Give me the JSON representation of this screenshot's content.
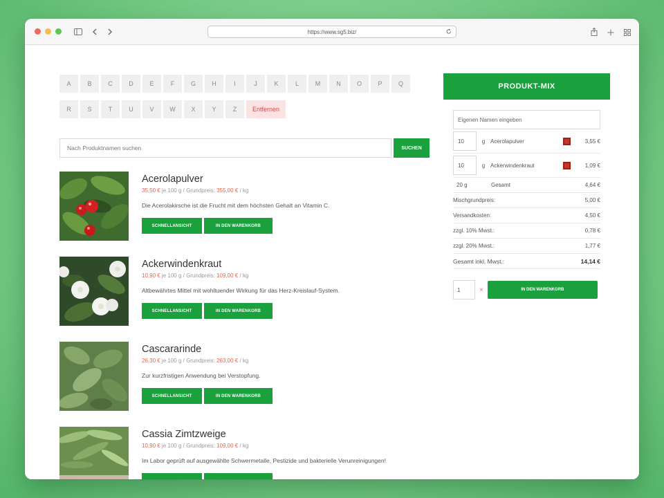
{
  "browser": {
    "url": "https://www.sg5.biz/"
  },
  "alphabet": {
    "row1": [
      "A",
      "B",
      "C",
      "D",
      "E",
      "F",
      "G",
      "H",
      "I",
      "J",
      "K",
      "L",
      "M",
      "N",
      "O",
      "P",
      "Q"
    ],
    "row2": [
      "R",
      "S",
      "T",
      "U",
      "V",
      "W",
      "X",
      "Y",
      "Z"
    ],
    "remove_label": "Entfernen"
  },
  "search": {
    "placeholder": "Nach Produktnamen suchen",
    "button": "SUCHEN"
  },
  "buttons": {
    "quick_view": "SCHNELLANSICHT",
    "add_to_cart": "IN DEN WARENKORB"
  },
  "products": [
    {
      "name": "Acerolapulver",
      "price": "35,50 €",
      "unit_text": " je 100 g / Grundpreis: ",
      "base_price": "355,00 €",
      "per": " / kg",
      "desc": "Die Acerolakirsche ist die Frucht mit dem höchsten Gehalt an Vitamin C."
    },
    {
      "name": "Ackerwindenkraut",
      "price": "10,90 €",
      "unit_text": " je 100 g / Grundpreis: ",
      "base_price": "109,00 €",
      "per": " / kg",
      "desc": "Altbewährtes Mittel mit wohltuender Wirkung für das Herz-Kreislauf-System."
    },
    {
      "name": "Cascararinde",
      "price": "26,30 €",
      "unit_text": " je 100 g / Grundpreis: ",
      "base_price": "263,00 €",
      "per": " / kg",
      "desc": "Zur kurzfristigen Anwendung bei Verstopfung."
    },
    {
      "name": "Cassia Zimtzweige",
      "price": "10,90 €",
      "unit_text": " je 100 g / Grundpreis: ",
      "base_price": "109,00 €",
      "per": " / kg",
      "desc": "Im Labor geprüft auf ausgewählte Schwermetalle, Pestizide und bakterielle Verunreinigungen!"
    }
  ],
  "mix": {
    "title": "PRODUKT-MIX",
    "name_placeholder": "Eigenen Namen eingeben",
    "items": [
      {
        "qty": "10",
        "unit": "g",
        "name": "Acerolapulver",
        "price": "3,55 €"
      },
      {
        "qty": "10",
        "unit": "g",
        "name": "Ackerwindenkraut",
        "price": "1,09 €"
      }
    ],
    "total_weight": "20 g",
    "total_label": "Gesamt",
    "total_value": "4,64 €",
    "summary": [
      {
        "label": "Mischgrundpreis:",
        "value": "5,00 €"
      },
      {
        "label": "Versandkosten:",
        "value": "4,50 €"
      },
      {
        "label": "zzgl. 10% Mwst.:",
        "value": "0,78 €"
      },
      {
        "label": "zzgl. 20% Mwst.:",
        "value": "1,77 €"
      }
    ],
    "grand_total_label": "Gesamt inkl. Mwst.:",
    "grand_total_value": "14,14 €",
    "add_qty": "1",
    "times": "×",
    "add_button": "IN DEN WARENKORB"
  },
  "colors": {
    "brand_green": "#1aa13d",
    "price_red": "#e0664d",
    "remove_bg": "#fbe3e3"
  }
}
